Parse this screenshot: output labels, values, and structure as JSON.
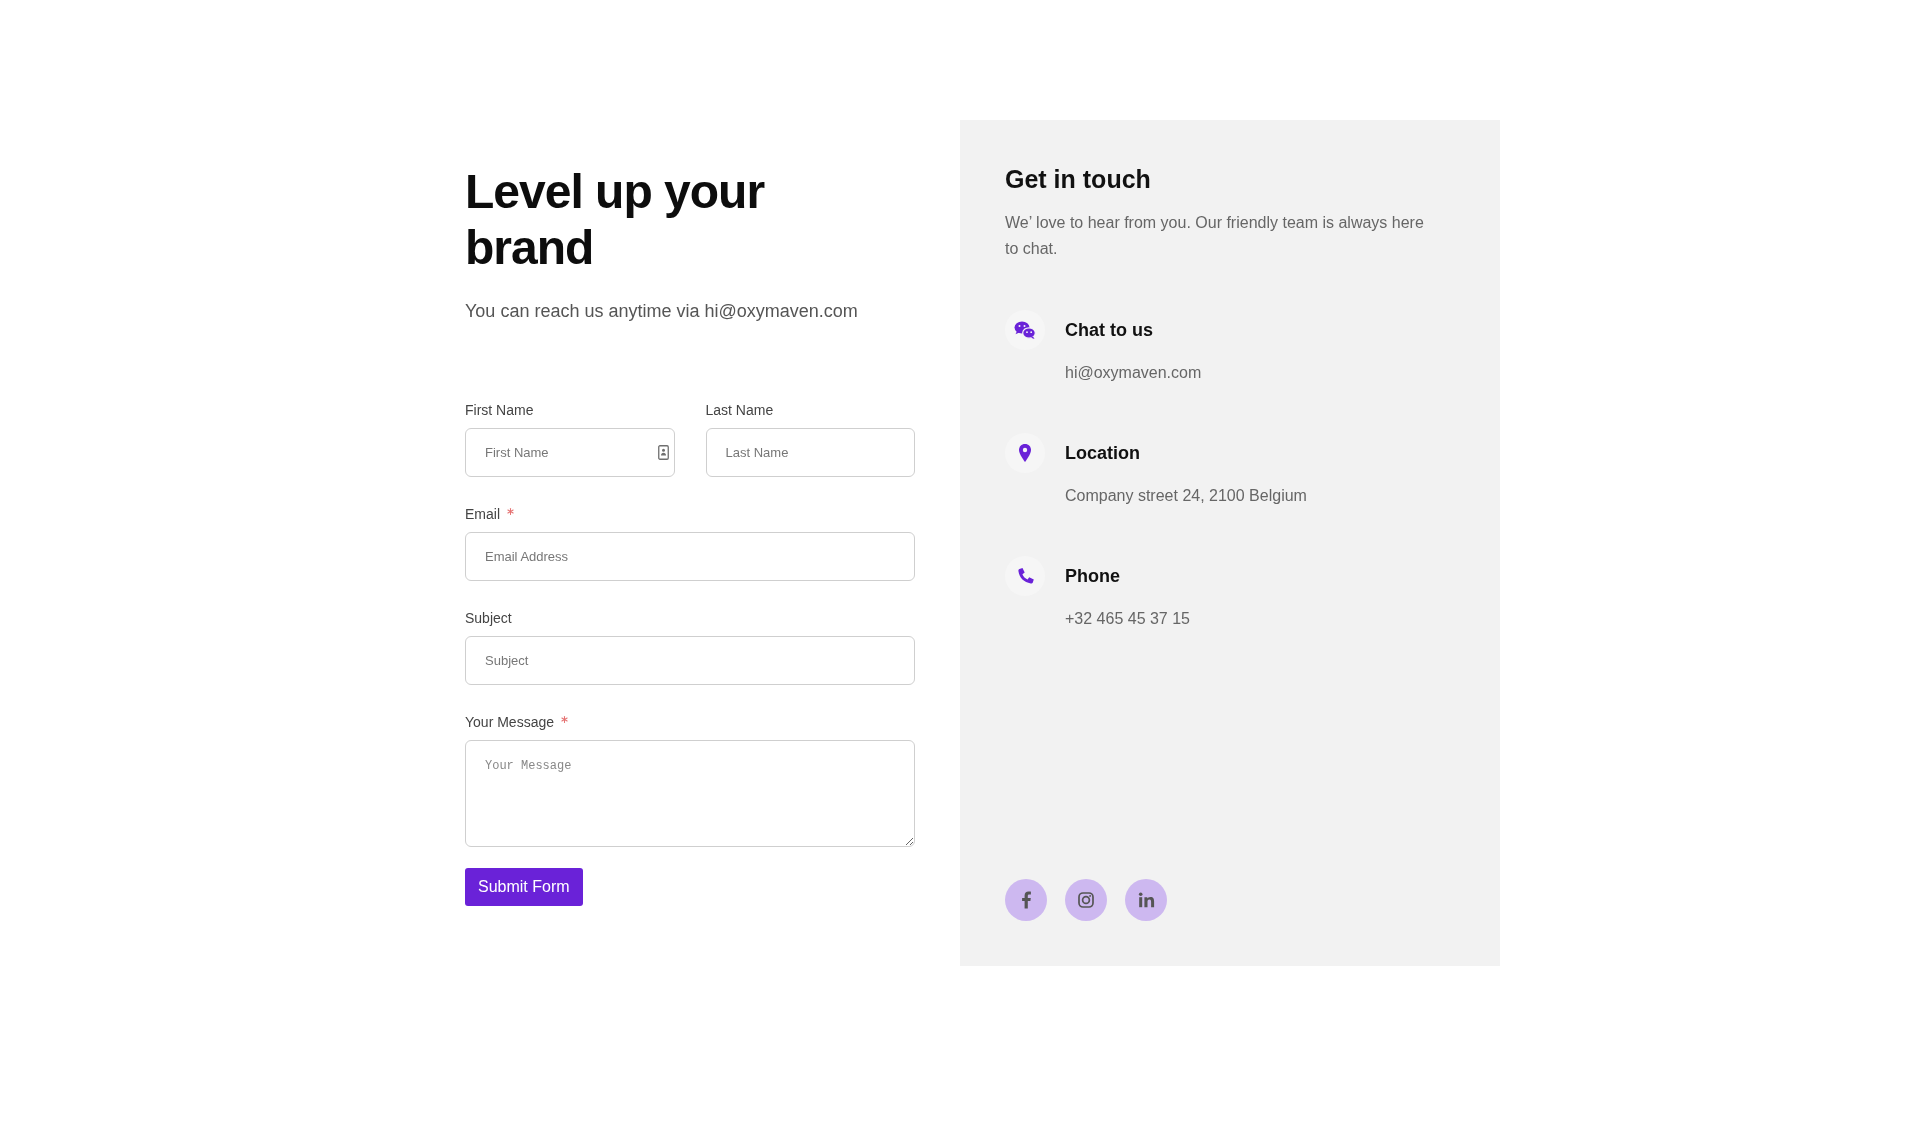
{
  "heading": "Level up your brand",
  "subtitle": "You can reach us anytime via hi@oxymaven.com",
  "form": {
    "rows": [
      {
        "fields": [
          {
            "kind": "input",
            "label": "First Name",
            "placeholder": "First Name",
            "required": false,
            "autofill": true
          },
          {
            "kind": "input",
            "label": "Last Name",
            "placeholder": "Last Name",
            "required": false,
            "autofill": false
          }
        ]
      },
      {
        "fields": [
          {
            "kind": "input",
            "label": "Email",
            "placeholder": "Email Address",
            "required": true,
            "autofill": false
          }
        ]
      },
      {
        "fields": [
          {
            "kind": "input",
            "label": "Subject",
            "placeholder": "Subject",
            "required": false,
            "autofill": false
          }
        ]
      },
      {
        "fields": [
          {
            "kind": "textarea",
            "label": "Your Message",
            "placeholder": "Your Message",
            "required": true,
            "autofill": false
          }
        ]
      }
    ],
    "submit_label": "Submit Form"
  },
  "contact_panel": {
    "title": "Get in touch",
    "description": "We’ love to hear from you. Our friendly team is always here to chat.",
    "items": [
      {
        "kind": "chat",
        "title": "Chat to us",
        "value": "hi@oxymaven.com"
      },
      {
        "kind": "location",
        "title": "Location",
        "value": "Company street 24, 2100 Belgium"
      },
      {
        "kind": "phone",
        "title": "Phone",
        "value": "+32 465 45 37 15"
      }
    ],
    "social": [
      {
        "kind": "facebook"
      },
      {
        "kind": "instagram"
      },
      {
        "kind": "linkedin"
      }
    ]
  }
}
